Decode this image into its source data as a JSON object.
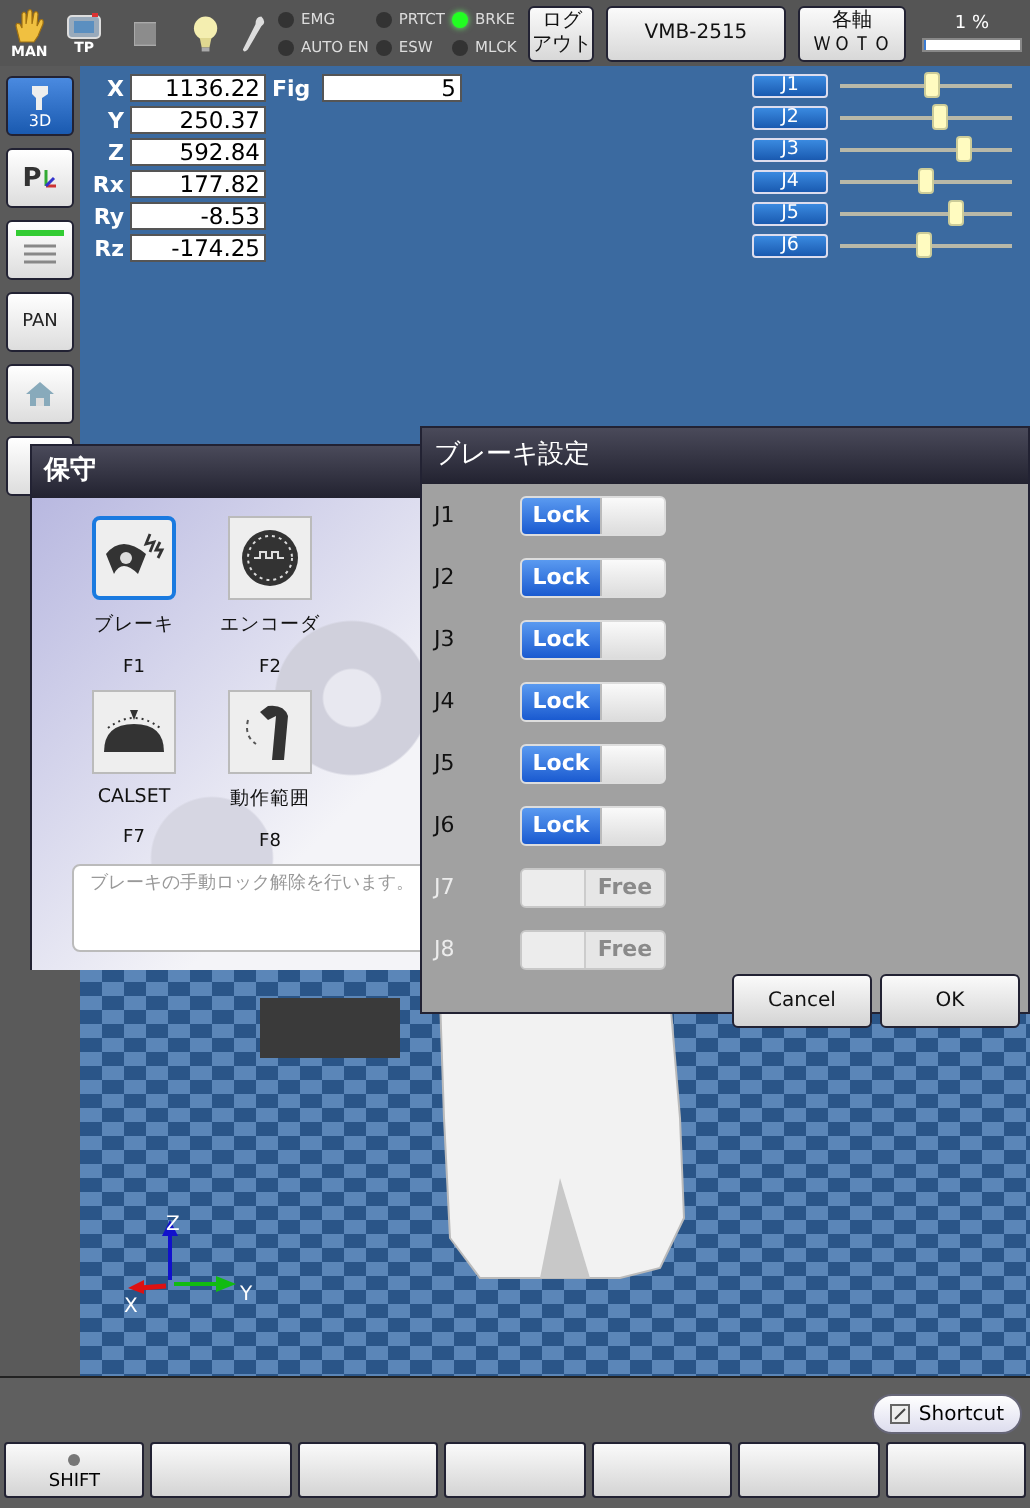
{
  "top_bar": {
    "mode_label": "MAN",
    "pendant_label": "TP",
    "indicators": [
      {
        "label": "EMG",
        "on": false
      },
      {
        "label": "AUTO EN",
        "on": false
      },
      {
        "label": "PRTCT",
        "on": false
      },
      {
        "label": "ESW",
        "on": false
      },
      {
        "label": "BRKE",
        "on": true
      },
      {
        "label": "MLCK",
        "on": false
      }
    ],
    "logout_button": [
      "ログ",
      "アウト"
    ],
    "model_button": "VMB-2515",
    "axis_button": [
      "各軸",
      "ＷＯＴＯ"
    ],
    "speed": {
      "reading": "1 %",
      "level": 0.01
    }
  },
  "sidebar": [
    {
      "kind": "view",
      "label": "3D",
      "selected": true
    },
    {
      "kind": "point",
      "label": "P",
      "selected": false
    },
    {
      "kind": "list",
      "selected": false
    },
    {
      "kind": "pan",
      "label": "PAN",
      "selected": false
    },
    {
      "kind": "home",
      "selected": false
    },
    {
      "kind": "blank",
      "selected": false
    }
  ],
  "position": [
    {
      "label": "X",
      "value": "1136.22"
    },
    {
      "label": "Y",
      "value": "250.37"
    },
    {
      "label": "Z",
      "value": "592.84"
    },
    {
      "label": "Rx",
      "value": "177.82"
    },
    {
      "label": "Ry",
      "value": "-8.53"
    },
    {
      "label": "Rz",
      "value": "-174.25"
    }
  ],
  "fig": {
    "label": "Fig",
    "value": "5"
  },
  "joint_sliders": [
    {
      "label": "J1",
      "level": 0.53
    },
    {
      "label": "J2",
      "level": 0.58
    },
    {
      "label": "J3",
      "level": 0.72
    },
    {
      "label": "J4",
      "level": 0.5
    },
    {
      "label": "J5",
      "level": 0.67
    },
    {
      "label": "J6",
      "level": 0.49
    }
  ],
  "axes": [
    "Z",
    "X",
    "Y"
  ],
  "maintenance": {
    "title": "保守",
    "items": [
      {
        "label": "ブレーキ",
        "key": "F1",
        "selected": true
      },
      {
        "label": "エンコーダ",
        "key": "F2",
        "selected": false
      },
      {
        "label": "CALSET",
        "key": "F7",
        "selected": false
      },
      {
        "label": "動作範囲",
        "key": "F8",
        "selected": false
      }
    ],
    "description": "ブレーキの手動ロック解除を行います。"
  },
  "brake": {
    "title": "ブレーキ設定",
    "joints": [
      {
        "label": "J1",
        "text": "Lock",
        "locked": true,
        "disabled": false
      },
      {
        "label": "J2",
        "text": "Lock",
        "locked": true,
        "disabled": false
      },
      {
        "label": "J3",
        "text": "Lock",
        "locked": true,
        "disabled": false
      },
      {
        "label": "J4",
        "text": "Lock",
        "locked": true,
        "disabled": false
      },
      {
        "label": "J5",
        "text": "Lock",
        "locked": true,
        "disabled": false
      },
      {
        "label": "J6",
        "text": "Lock",
        "locked": true,
        "disabled": false
      },
      {
        "label": "J7",
        "text": "Free",
        "locked": false,
        "disabled": true
      },
      {
        "label": "J8",
        "text": "Free",
        "locked": false,
        "disabled": true
      }
    ],
    "buttons": [
      "Cancel",
      "OK"
    ]
  },
  "shortcut_button": "Shortcut",
  "function_keys": [
    {
      "kind": "shift",
      "label": "SHIFT"
    },
    {
      "kind": "blank"
    },
    {
      "kind": "blank"
    },
    {
      "kind": "blank"
    },
    {
      "kind": "blank"
    },
    {
      "kind": "blank"
    },
    {
      "kind": "blank"
    }
  ]
}
